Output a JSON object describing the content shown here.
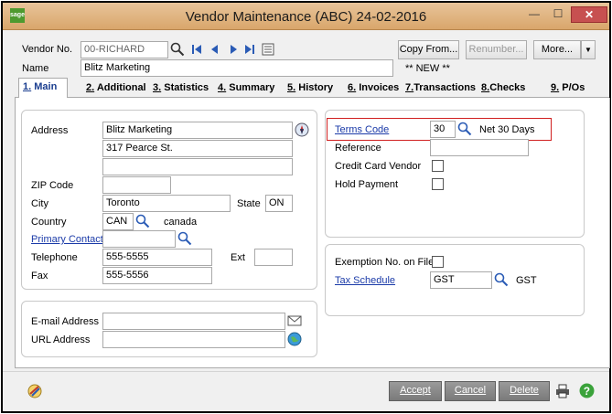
{
  "window": {
    "title": "Vendor Maintenance (ABC) 24-02-2016",
    "logo": "sage",
    "min_symbol": "—",
    "max_symbol": "☐",
    "close_symbol": "✕"
  },
  "header": {
    "vendor_no_label": "Vendor No.",
    "vendor_no_value": "00-RICHARD",
    "name_label": "Name",
    "name_value": "Blitz Marketing",
    "status_text": "** NEW **",
    "copy_from_label": "Copy From...",
    "renumber_label": "Renumber...",
    "more_label": "More..."
  },
  "tabs": [
    {
      "num": "1.",
      "label": "Main"
    },
    {
      "num": "2.",
      "label": "Additional"
    },
    {
      "num": "3.",
      "label": "Statistics"
    },
    {
      "num": "4.",
      "label": "Summary"
    },
    {
      "num": "5.",
      "label": "History"
    },
    {
      "num": "6.",
      "label": "Invoices"
    },
    {
      "num": "7.",
      "label": "Transactions"
    },
    {
      "num": "8.",
      "label": "Checks"
    },
    {
      "num": "9.",
      "label": "P/Os"
    }
  ],
  "address": {
    "address_label": "Address",
    "line1": "Blitz Marketing",
    "line2": "317 Pearce St.",
    "line3": "",
    "zip_label": "ZIP Code",
    "zip_value": "",
    "city_label": "City",
    "city_value": "Toronto",
    "state_label": "State",
    "state_value": "ON",
    "country_label": "Country",
    "country_value": "CAN",
    "country_name": "canada",
    "primary_contact_label": "Primary Contact",
    "primary_contact_value": "",
    "telephone_label": "Telephone",
    "telephone_value": "555-5555",
    "ext_label": "Ext",
    "ext_value": "",
    "fax_label": "Fax",
    "fax_value": "555-5556"
  },
  "internet": {
    "email_label": "E-mail Address",
    "email_value": "",
    "url_label": "URL Address",
    "url_value": ""
  },
  "terms": {
    "terms_code_label": "Terms Code",
    "terms_code_value": "30",
    "terms_desc": "Net 30 Days",
    "reference_label": "Reference",
    "reference_value": "",
    "credit_card_label": "Credit Card Vendor",
    "hold_payment_label": "Hold Payment",
    "credit_card_checked": false,
    "hold_payment_checked": false
  },
  "tax": {
    "exemption_label": "Exemption No. on File",
    "exemption_checked": false,
    "tax_schedule_label": "Tax Schedule",
    "tax_schedule_value": "GST",
    "tax_schedule_desc": "GST"
  },
  "footer": {
    "accept_label": "Accept",
    "cancel_label": "Cancel",
    "delete_label": "Delete"
  },
  "colors": {
    "titlebar": "#d9a66b",
    "link": "#1a3aa8",
    "highlight": "#d02020",
    "close": "#c75050"
  }
}
